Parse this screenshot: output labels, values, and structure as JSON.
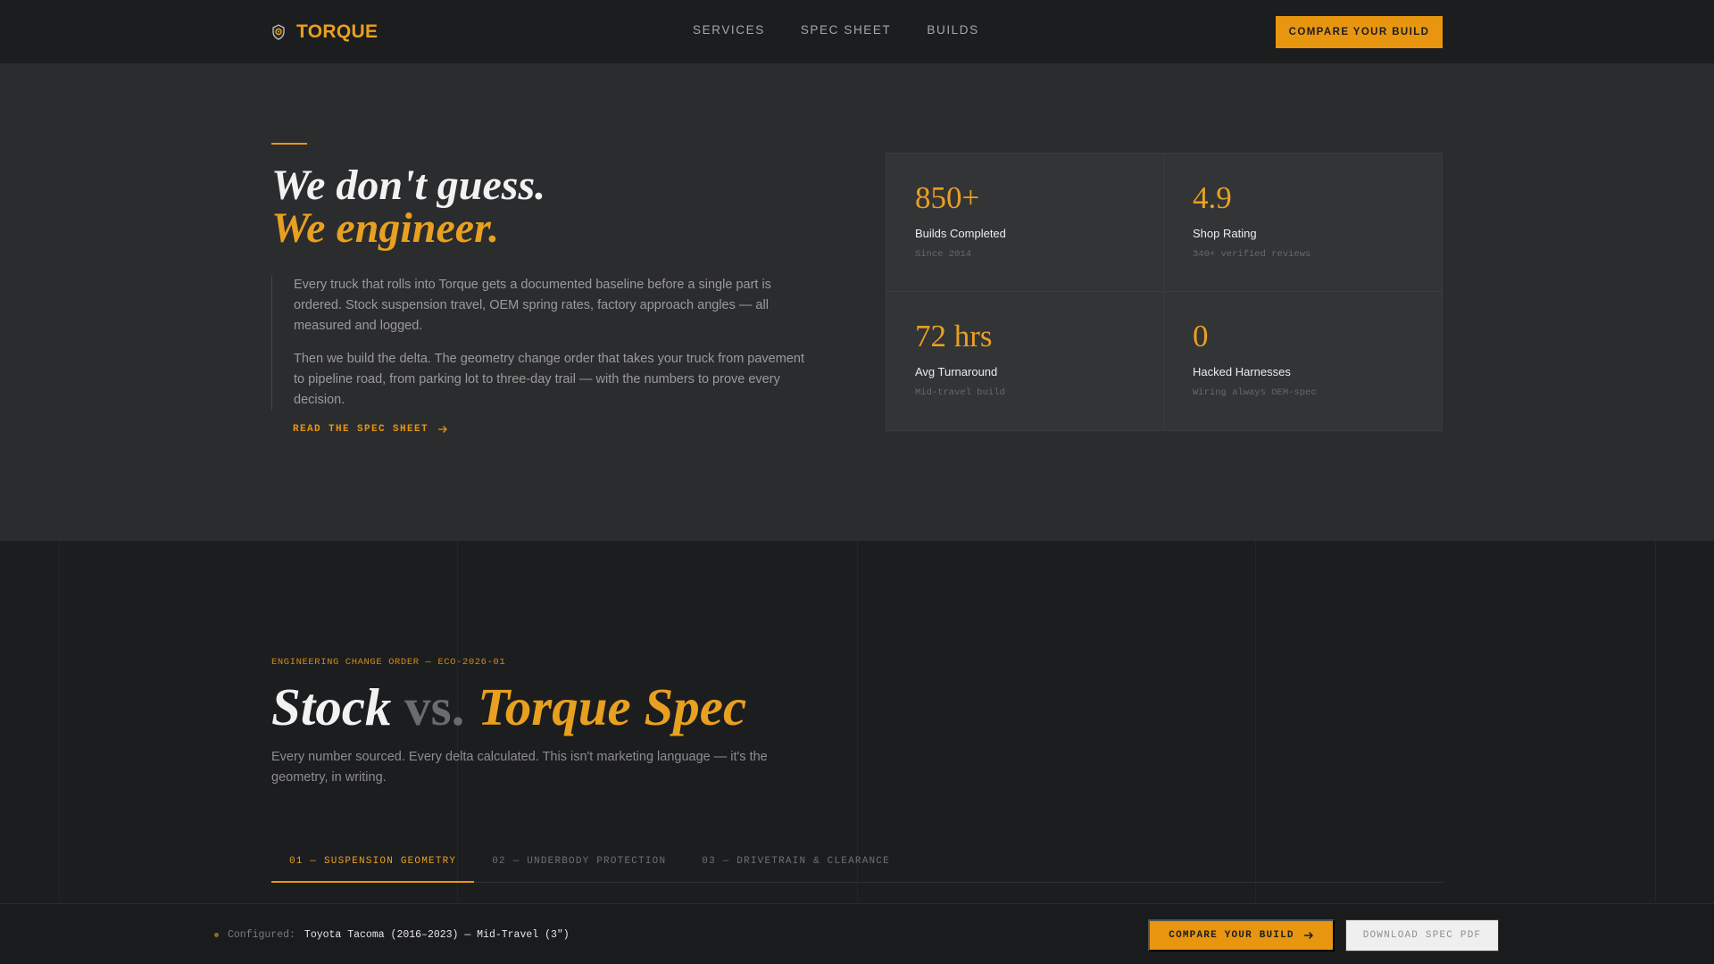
{
  "brand": {
    "name": "TORQUE",
    "icon": "shield-gear-icon"
  },
  "nav": {
    "links": [
      "SERVICES",
      "SPEC SHEET",
      "BUILDS"
    ],
    "cta_label": "COMPARE YOUR BUILD"
  },
  "hero": {
    "title_line1": "We don't guess.",
    "title_line2": "We engineer.",
    "paragraphs": [
      "Every truck that rolls into Torque gets a documented baseline before a single part is ordered. Stock suspension travel, OEM spring rates, factory approach angles — all measured and logged.",
      "Then we build the delta. The geometry change order that takes your truck from pavement to pipeline road, from parking lot to three-day trail — with the numbers to prove every decision."
    ],
    "link_label": "READ THE SPEC SHEET"
  },
  "stats": [
    {
      "value": "850+",
      "label": "Builds Completed",
      "sub": "Since 2014"
    },
    {
      "value": "4.9",
      "label": "Shop Rating",
      "sub": "340+ verified reviews"
    },
    {
      "value": "72 hrs",
      "label": "Avg Turnaround",
      "sub": "Mid-travel build"
    },
    {
      "value": "0",
      "label": "Hacked Harnesses",
      "sub": "Wiring always OEM-spec"
    }
  ],
  "eco": {
    "label": "ENGINEERING CHANGE ORDER — ECO-2026-01",
    "title_stock": "Stock",
    "title_vs": "vs.",
    "title_spec": "Torque Spec",
    "description": "Every number sourced. Every delta calculated. This isn't marketing language — it's the geometry, in writing.",
    "tabs": [
      "01 — SUSPENSION GEOMETRY",
      "02 — UNDERBODY PROTECTION",
      "03 — DRIVETRAIN & CLEARANCE"
    ],
    "active_tab": 0
  },
  "bottom_bar": {
    "config_key": "Configured:",
    "config_value": "Toyota Tacoma (2016–2023) — Mid-Travel (3\")",
    "cta_label": "COMPARE YOUR BUILD",
    "pdf_label": "DOWNLOAD SPEC PDF"
  },
  "colors": {
    "accent": "#e8960f",
    "accent_text": "#e8a020",
    "bg": "#1c1d1f",
    "hero_bg": "#2b2c2e"
  }
}
